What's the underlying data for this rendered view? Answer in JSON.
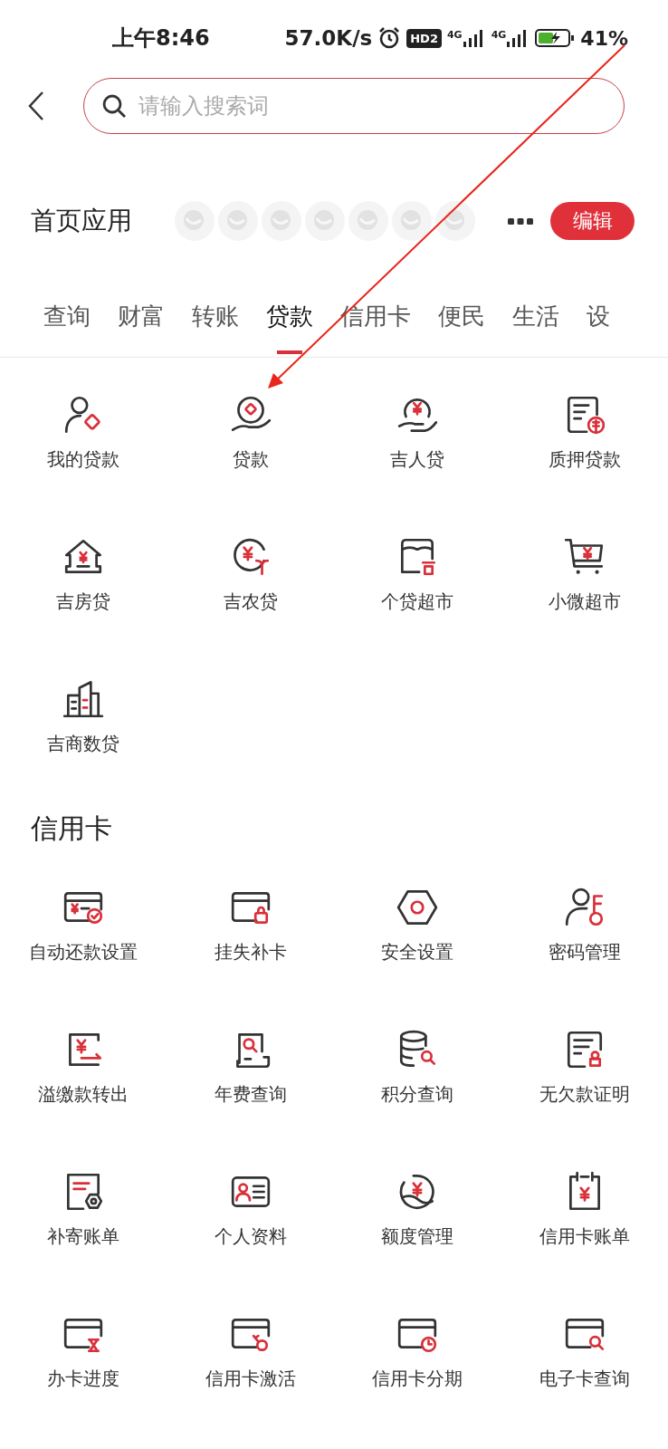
{
  "status_bar": {
    "time": "上午8:46",
    "speed": "57.0K/s",
    "hd_badge": "HD2",
    "networks": [
      "4G",
      "4G"
    ],
    "battery": "41%"
  },
  "search": {
    "placeholder": "请输入搜索词"
  },
  "home_apps": {
    "title": "首页应用",
    "edit_button": "编辑"
  },
  "tabs": [
    {
      "label": "查询",
      "selected": false
    },
    {
      "label": "财富",
      "selected": false
    },
    {
      "label": "转账",
      "selected": false
    },
    {
      "label": "贷款",
      "selected": true
    },
    {
      "label": "信用卡",
      "selected": false
    },
    {
      "label": "便民",
      "selected": false
    },
    {
      "label": "生活",
      "selected": false
    },
    {
      "label": "设",
      "selected": false
    }
  ],
  "sections": [
    {
      "items": [
        {
          "label": "我的贷款"
        },
        {
          "label": "贷款"
        },
        {
          "label": "吉人贷"
        },
        {
          "label": "质押贷款"
        },
        {
          "label": "吉房贷"
        },
        {
          "label": "吉农贷"
        },
        {
          "label": "个贷超市"
        },
        {
          "label": "小微超市"
        },
        {
          "label": "吉商数贷"
        }
      ]
    },
    {
      "title": "信用卡",
      "items": [
        {
          "label": "自动还款设置"
        },
        {
          "label": "挂失补卡"
        },
        {
          "label": "安全设置"
        },
        {
          "label": "密码管理"
        },
        {
          "label": "溢缴款转出"
        },
        {
          "label": "年费查询"
        },
        {
          "label": "积分查询"
        },
        {
          "label": "无欠款证明"
        },
        {
          "label": "补寄账单"
        },
        {
          "label": "个人资料"
        },
        {
          "label": "额度管理"
        },
        {
          "label": "信用卡账单"
        },
        {
          "label": "办卡进度"
        },
        {
          "label": "信用卡激活"
        },
        {
          "label": "信用卡分期"
        },
        {
          "label": "电子卡查询"
        }
      ]
    }
  ]
}
